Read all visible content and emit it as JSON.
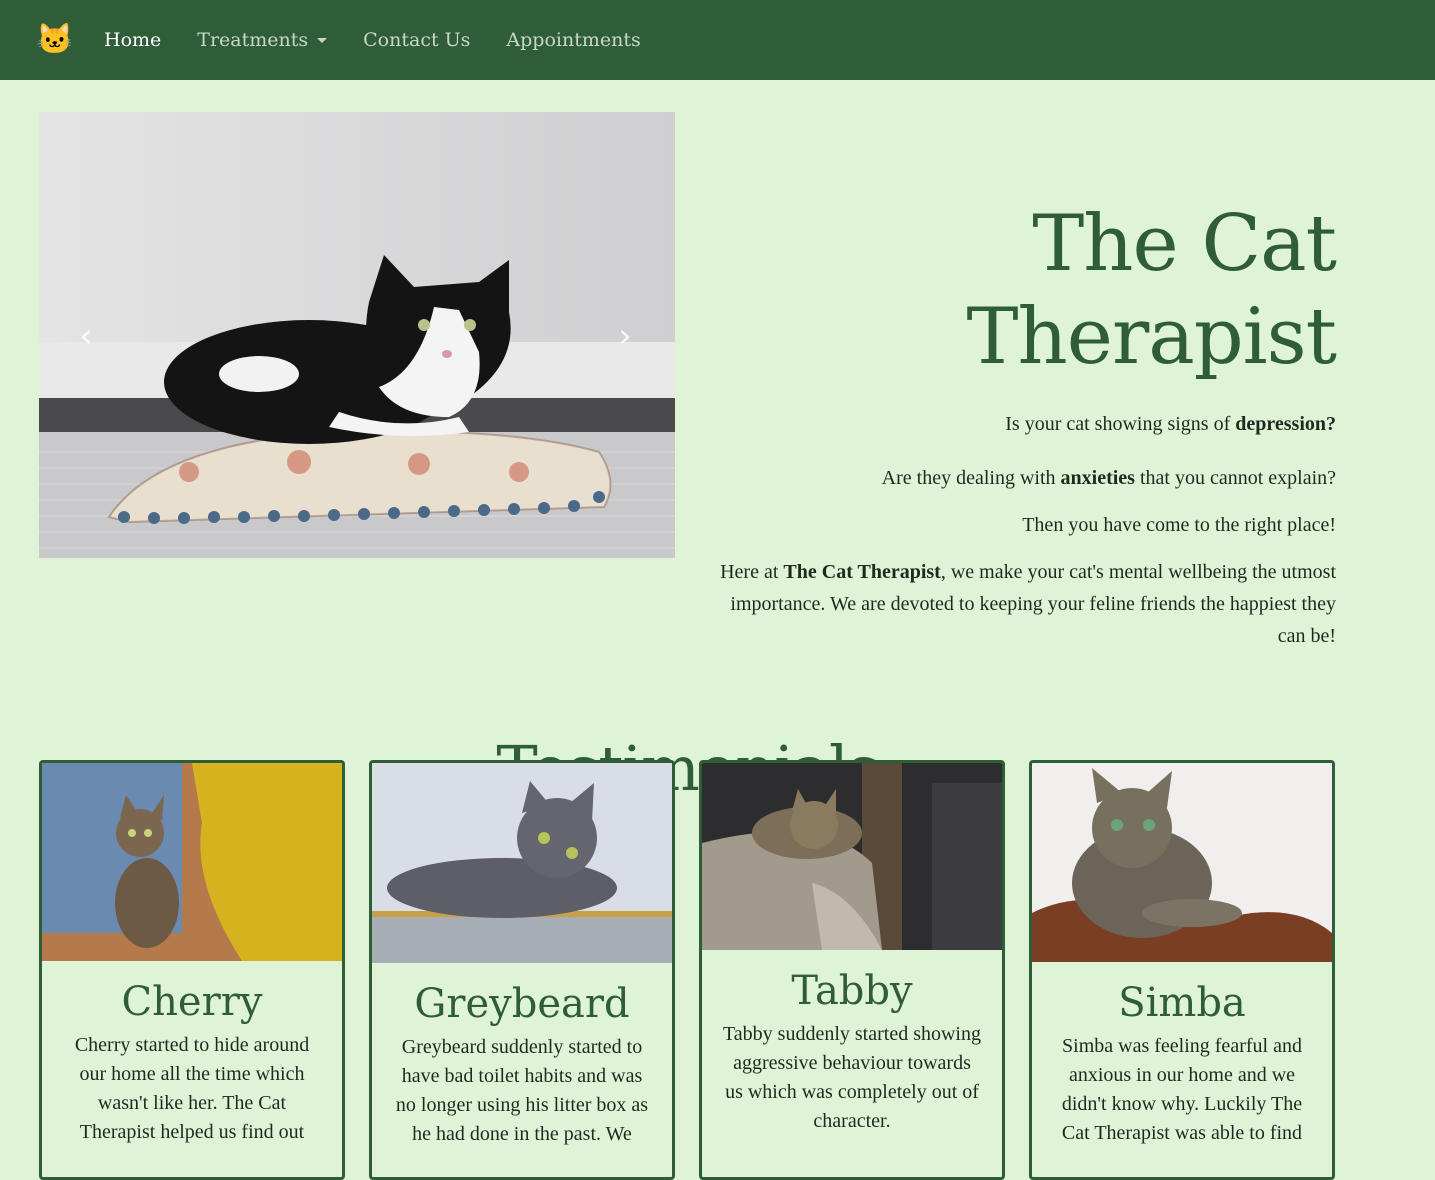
{
  "nav": {
    "logo_icon": "cat-face-icon",
    "logo_glyph": "🐱",
    "items": [
      {
        "label": "Home",
        "active": true
      },
      {
        "label": "Treatments",
        "dropdown": true
      },
      {
        "label": "Contact Us"
      },
      {
        "label": "Appointments"
      }
    ]
  },
  "carousel": {
    "prev_icon": "chevron-left-icon",
    "next_icon": "chevron-right-icon",
    "prev_glyph": "‹",
    "next_glyph": "›"
  },
  "hero": {
    "title_line1": "The Cat",
    "title_line2": "Therapist",
    "p1_pre": "Is your cat showing signs of ",
    "p1_bold": "depression?",
    "p2_pre": "Are they dealing with ",
    "p2_bold": "anxieties",
    "p2_post": " that you cannot explain?",
    "p3": "Then you have come to the right place!",
    "p4_pre": "Here at ",
    "p4_bold": "The Cat Therapist",
    "p4_post": ", we make your cat's mental wellbeing the utmost importance. We are devoted to keeping your feline friends the happiest they can be!"
  },
  "testimonials": {
    "title": "Testimonials",
    "cards": [
      {
        "name": "Cherry",
        "text": "Cherry started to hide around our home all the time which wasn't like her. The Cat Therapist helped us find out"
      },
      {
        "name": "Greybeard",
        "text": "Greybeard suddenly started to have bad toilet habits and was no longer using his litter box as he had done in the past. We"
      },
      {
        "name": "Tabby",
        "text": "Tabby suddenly started showing aggressive behaviour towards us which was completely out of character."
      },
      {
        "name": "Simba",
        "text": "Simba was feeling fearful and anxious in our home and we didn't know why. Luckily The Cat Therapist was able to find"
      }
    ]
  },
  "colors": {
    "navbar": "#2f5d38",
    "background": "#dff3d7",
    "accent": "#2f5d38"
  }
}
